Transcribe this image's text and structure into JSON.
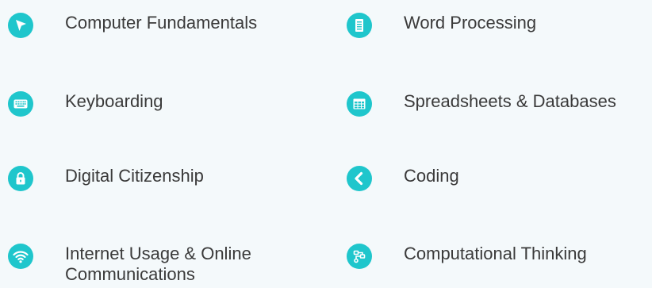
{
  "topics": [
    {
      "label": "Computer Fundamentals",
      "icon": "cursor-arrow-icon"
    },
    {
      "label": "Word Processing",
      "icon": "document-icon"
    },
    {
      "label": "Keyboarding",
      "icon": "keyboard-icon"
    },
    {
      "label": "Spreadsheets & Databases",
      "icon": "spreadsheet-grid-icon"
    },
    {
      "label": "Digital Citizenship",
      "icon": "lock-icon"
    },
    {
      "label": "Coding",
      "icon": "chevron-left-icon"
    },
    {
      "label": "Internet Usage & Online Communications",
      "icon": "wifi-icon"
    },
    {
      "label": "Computational Thinking",
      "icon": "flowchart-icon"
    }
  ],
  "colors": {
    "icon_bg": "#1fc6cc",
    "text": "#3a3a3a",
    "page_bg": "#f4f9fb"
  }
}
